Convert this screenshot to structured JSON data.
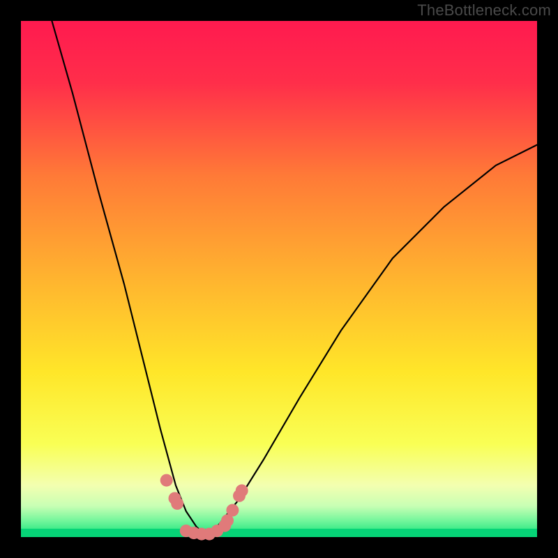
{
  "watermark": "TheBottleneck.com",
  "chart_data": {
    "type": "line",
    "title": "",
    "xlabel": "",
    "ylabel": "",
    "xlim": [
      0,
      100
    ],
    "ylim": [
      0,
      100
    ],
    "background_gradient": {
      "top": "#ff1a4f",
      "mid_upper": "#ff8a33",
      "mid": "#ffe629",
      "mid_lower": "#f7ff6e",
      "green_band": "#1fe06a",
      "bottom_strip": "#00d47a"
    },
    "series": [
      {
        "name": "left-curve",
        "stroke": "#000000",
        "points": [
          {
            "x": 6,
            "y": 100
          },
          {
            "x": 10,
            "y": 86
          },
          {
            "x": 15,
            "y": 67
          },
          {
            "x": 20,
            "y": 49
          },
          {
            "x": 24,
            "y": 33
          },
          {
            "x": 27,
            "y": 21
          },
          {
            "x": 30,
            "y": 10
          },
          {
            "x": 32,
            "y": 5
          },
          {
            "x": 34,
            "y": 2
          },
          {
            "x": 35.5,
            "y": 0.6
          }
        ]
      },
      {
        "name": "right-curve",
        "stroke": "#000000",
        "points": [
          {
            "x": 35.5,
            "y": 0.6
          },
          {
            "x": 38,
            "y": 2
          },
          {
            "x": 42,
            "y": 7
          },
          {
            "x": 47,
            "y": 15
          },
          {
            "x": 54,
            "y": 27
          },
          {
            "x": 62,
            "y": 40
          },
          {
            "x": 72,
            "y": 54
          },
          {
            "x": 82,
            "y": 64
          },
          {
            "x": 92,
            "y": 72
          },
          {
            "x": 100,
            "y": 76
          }
        ]
      }
    ],
    "markers": {
      "color": "#e07a7a",
      "radius_px": 9,
      "points": [
        {
          "x": 28.2,
          "y": 11.0
        },
        {
          "x": 29.8,
          "y": 7.5
        },
        {
          "x": 30.3,
          "y": 6.5
        },
        {
          "x": 32.0,
          "y": 1.2
        },
        {
          "x": 33.5,
          "y": 0.8
        },
        {
          "x": 35.0,
          "y": 0.6
        },
        {
          "x": 36.5,
          "y": 0.6
        },
        {
          "x": 38.0,
          "y": 1.2
        },
        {
          "x": 39.5,
          "y": 2.2
        },
        {
          "x": 40.0,
          "y": 3.2
        },
        {
          "x": 41.0,
          "y": 5.2
        },
        {
          "x": 42.3,
          "y": 8.0
        },
        {
          "x": 42.8,
          "y": 9.0
        }
      ]
    }
  }
}
